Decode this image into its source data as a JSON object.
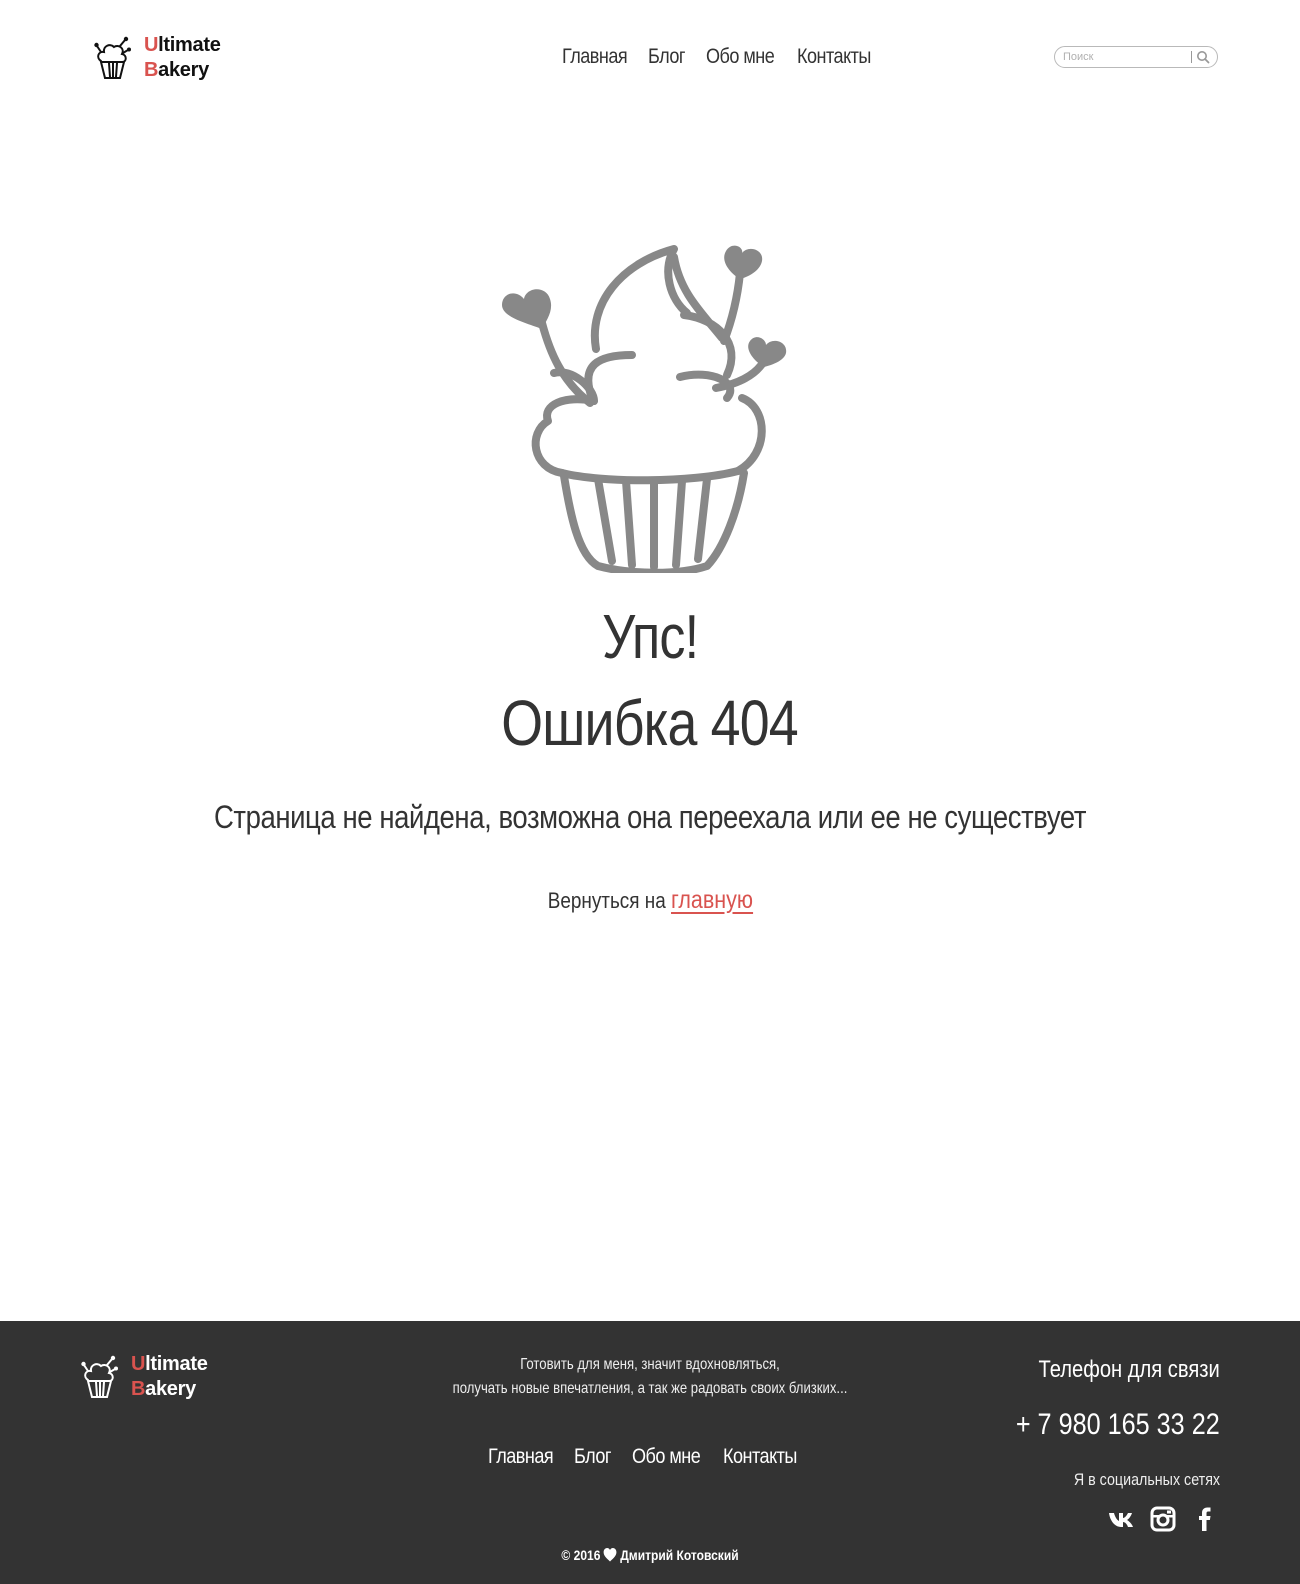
{
  "brand": {
    "first_top": "U",
    "rest_top": "ltimate",
    "first_bottom": "B",
    "rest_bottom": "akery"
  },
  "nav": [
    "Главная",
    "Блог",
    "Обо мне",
    "Контакты"
  ],
  "search": {
    "placeholder": "Поиск",
    "value": ""
  },
  "error": {
    "title": "Упс!",
    "code_text": "Ошибка 404",
    "message": "Страница не найдена, возможна она переехала или ее не существует",
    "back_prefix": "Вернуться на",
    "back_link": "главную"
  },
  "footer": {
    "tagline_line1": "Готовить для меня, значит вдохновляться,",
    "tagline_line2": "получать новые впечатления, а так же радовать своих близких...",
    "nav": [
      "Главная",
      "Блог",
      "Обо мне",
      "Контакты"
    ],
    "phone_label": "Телефон для связи",
    "phone": "+ 7 980 165 33 22",
    "social_label": "Я в социальных сетях",
    "socials": [
      "vk-icon",
      "instagram-icon",
      "facebook-icon"
    ],
    "copyright_year": "© 2016",
    "copyright_name": "Дмитрий Котовский"
  },
  "colors": {
    "accent": "#d9534f",
    "footer_bg": "#333333",
    "text": "#333333",
    "cupcake_gray": "#888888"
  }
}
